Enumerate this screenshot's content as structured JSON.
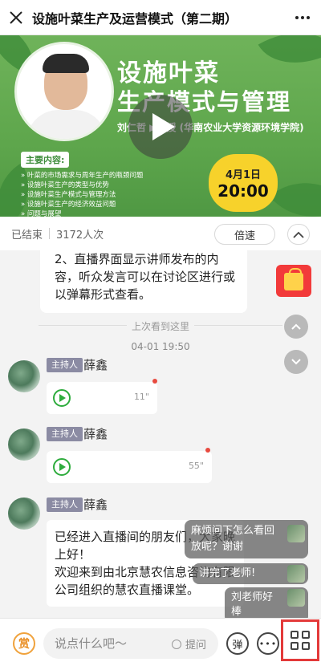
{
  "header": {
    "title": "设施叶菜生产及运营模式（第二期）"
  },
  "banner": {
    "title_line1": "设施叶菜",
    "title_line2": "生产模式与管理",
    "speaker": "刘仁哲 ▶教授 (华南农业大学资源环境学院)",
    "content_heading": "主要内容:",
    "content_items": [
      "» 叶菜的市场需求与周年生产的瓶颈问题",
      "» 设施叶菜生产的类型与优势",
      "» 设施叶菜生产模式与管理方法",
      "» 设施叶菜生产的经济效益问题",
      "» 问题与展望"
    ],
    "date": "4月1日",
    "time": "20:00"
  },
  "status": {
    "state": "已结束",
    "views": "3172人次",
    "speed_label": "倍速"
  },
  "chat": {
    "top_message": "2、直播界面显示讲师发布的内容，听众发言可以在讨论区进行或以弹幕形式查看。",
    "divider_text": "上次看到这里",
    "timestamp": "04-01 19:50",
    "messages": [
      {
        "role": "主持人",
        "name": "薛鑫",
        "duration": "11\""
      },
      {
        "role": "主持人",
        "name": "薛鑫",
        "duration": "55\""
      },
      {
        "role": "主持人",
        "name": "薛鑫",
        "text": "已经进入直播间的朋友们，大家晚上好！\n欢迎来到由北京慧农信息咨询有限公司组织的慧农直播课堂。"
      }
    ]
  },
  "danmu": [
    "麻烦问下怎么看回放呢？谢谢",
    "讲完了老师!",
    "刘老师好棒"
  ],
  "bottom": {
    "reward_label": "赏",
    "input_placeholder": "说点什么吧～",
    "ask_label": "提问",
    "danmu_label": "弹"
  }
}
